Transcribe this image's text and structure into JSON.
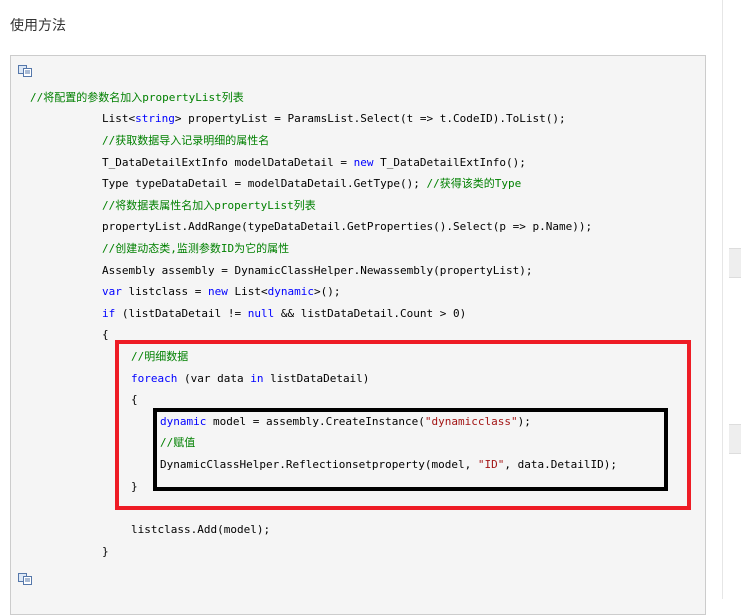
{
  "heading": "使用方法",
  "code": {
    "top_comment": "//将配置的参数名加入propertyList列表",
    "l1_pre": "List<",
    "l1_kw": "string",
    "l1_post": "> propertyList = ParamsList.Select(t => t.CodeID).ToList();",
    "c2": "//获取数据导入记录明细的属性名",
    "l3_pre": "T_DataDetailExtInfo modelDataDetail = ",
    "l3_kw": "new",
    "l3_post": " T_DataDetailExtInfo();",
    "l4_pre": "Type typeDataDetail = modelDataDetail.GetType(); ",
    "l4_cm": "//获得该类的Type",
    "c5": "//将数据表属性名加入propertyList列表",
    "l6": "propertyList.AddRange(typeDataDetail.GetProperties().Select(p => p.Name));",
    "c7": "//创建动态类,监测参数ID为它的属性",
    "l8": "Assembly assembly = DynamicClassHelper.Newassembly(propertyList);",
    "l9_kw1": "var",
    "l9_mid": " listclass = ",
    "l9_kw2": "new",
    "l9_mid2": " List<",
    "l9_kw3": "dynamic",
    "l9_post": ">();",
    "l10_kw": "if",
    "l10_mid": " (listDataDetail != ",
    "l10_kw2": "null",
    "l10_post": " && listDataDetail.Count > 0)",
    "brace_open": "{",
    "c11": "//明细数据",
    "l12_kw": "foreach",
    "l12_mid": " (var data ",
    "l12_kw2": "in",
    "l12_post": " listDataDetail)",
    "l13_kw": "dynamic",
    "l13_mid": " model = assembly.CreateInstance(",
    "l13_str": "\"dynamicclass\"",
    "l13_post": ");",
    "c14": "//赋值",
    "l15_pre": "DynamicClassHelper.Reflectionsetproperty(model, ",
    "l15_str": "\"ID\"",
    "l15_post": ", data.DetailID);",
    "brace_close": "}",
    "l16": "listclass.Add(model);"
  },
  "icons": {
    "copy_top": "copy-icon",
    "copy_bottom": "copy-icon"
  },
  "colors": {
    "comment": "#008000",
    "keyword": "#0000ff",
    "string": "#a31515",
    "highlight_red": "#ee1c25",
    "highlight_black": "#000000"
  }
}
